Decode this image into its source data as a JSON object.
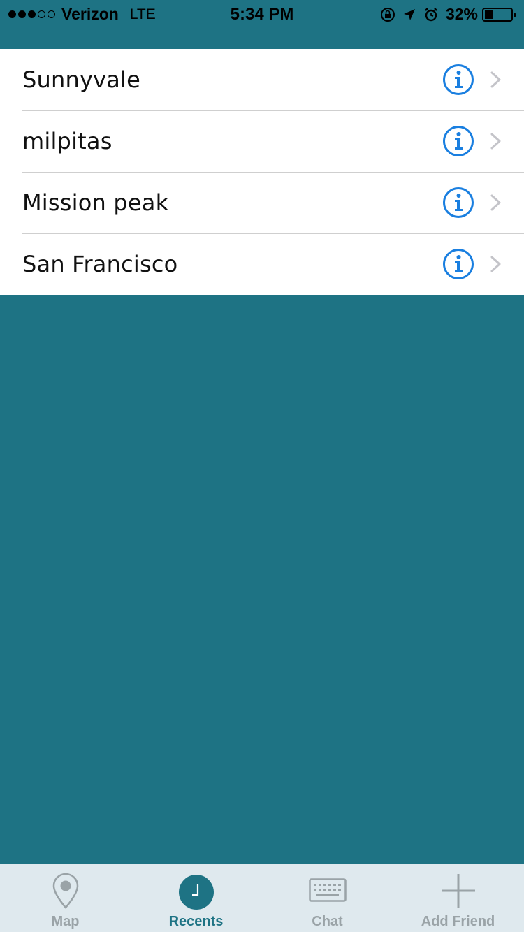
{
  "status_bar": {
    "carrier": "Verizon",
    "network": "LTE",
    "time": "5:34 PM",
    "battery_percent": "32%",
    "battery_level": 0.32,
    "signal_bars": 3,
    "signal_total": 5
  },
  "locations": [
    {
      "name": "Sunnyvale"
    },
    {
      "name": "milpitas"
    },
    {
      "name": "Mission peak"
    },
    {
      "name": "San Francisco"
    }
  ],
  "tabbar": {
    "tabs": [
      {
        "label": "Map",
        "icon": "map-pin-icon",
        "active": false
      },
      {
        "label": "Recents",
        "icon": "clock-icon",
        "active": true
      },
      {
        "label": "Chat",
        "icon": "keyboard-icon",
        "active": false
      },
      {
        "label": "Add Friend",
        "icon": "plus-icon",
        "active": false
      }
    ]
  },
  "colors": {
    "accent": "#1e7384",
    "info": "#1a7fe0",
    "list_background": "#ffffff",
    "tabbar_background": "#dfe9ee"
  }
}
